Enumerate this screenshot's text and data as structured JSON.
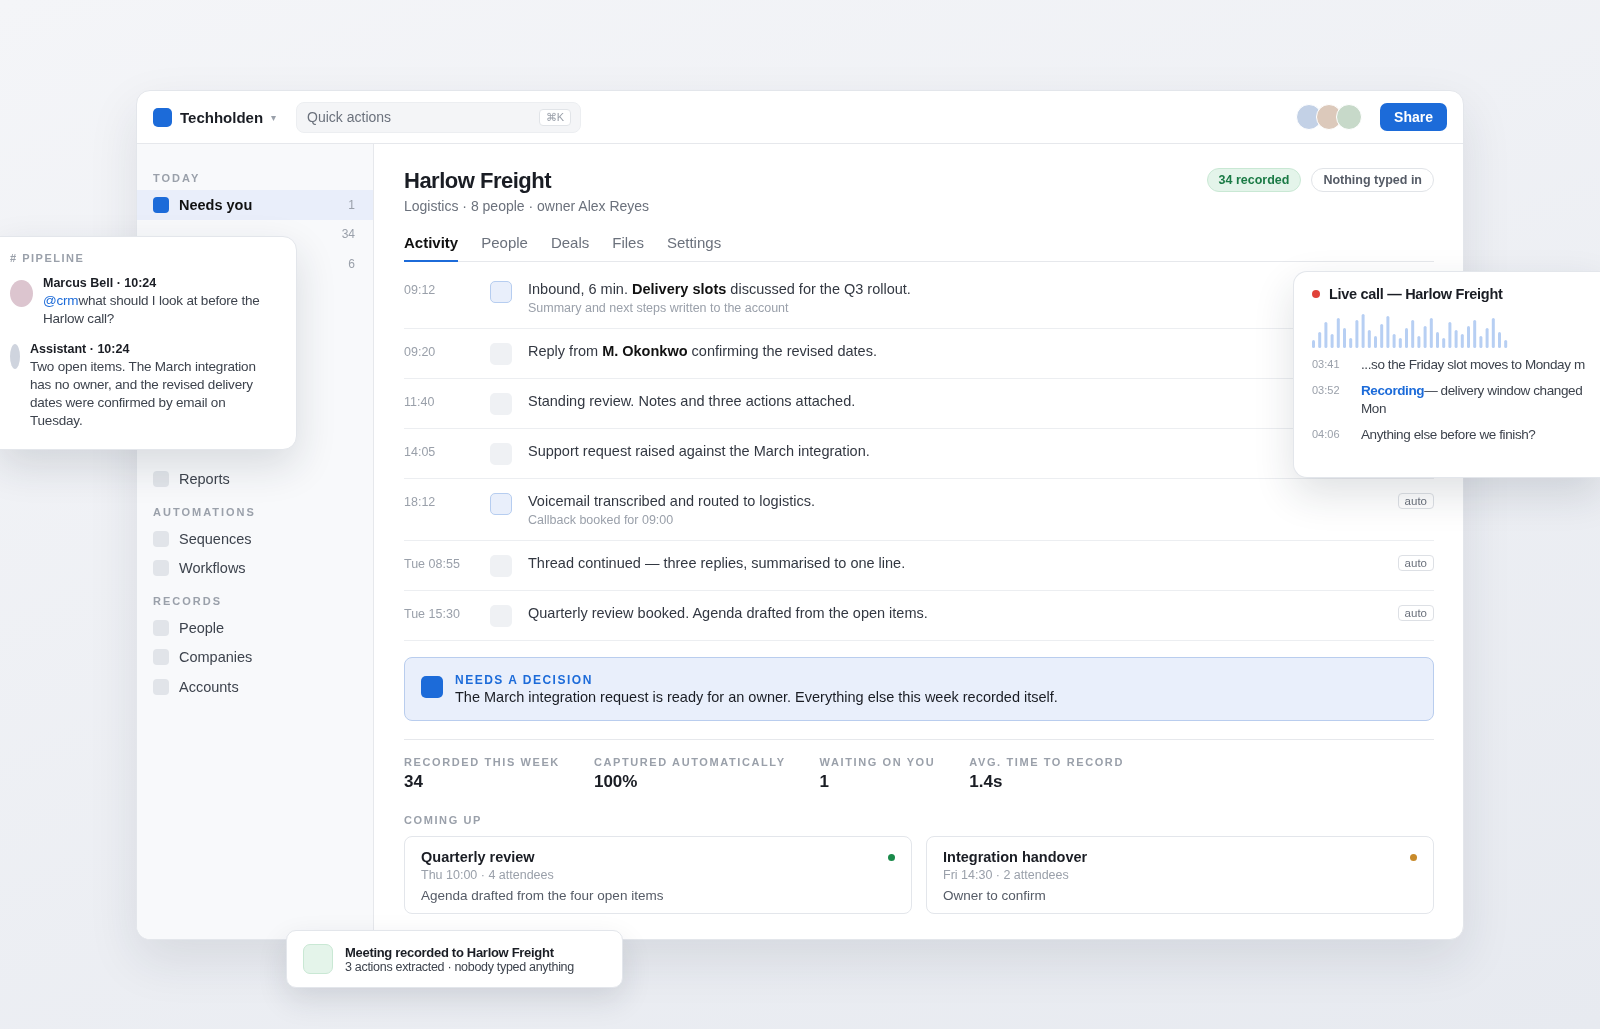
{
  "workspace": {
    "name": "Techholden",
    "caret": "▾"
  },
  "quick_actions": {
    "placeholder": "Quick actions",
    "shortcut": "⌘K"
  },
  "avatars": [
    {
      "color": "#c3d1e6"
    },
    {
      "color": "#dcc9bb"
    },
    {
      "color": "#c7d9c9"
    }
  ],
  "share_button": "Share",
  "sidebar": {
    "sections": [
      {
        "title": "TODAY",
        "items": [
          {
            "label": "Needs you",
            "count": "1",
            "selected": true
          },
          {
            "count": "34",
            "selected": false
          },
          {
            "count": "6",
            "selected": false
          }
        ]
      },
      {
        "items": [
          {
            "label": "Reports",
            "selected": false
          }
        ]
      },
      {
        "title": "AUTOMATIONS",
        "items": [
          {
            "label": "Sequences",
            "selected": false
          },
          {
            "label": "Workflows",
            "selected": false
          }
        ]
      },
      {
        "title": "RECORDS",
        "items": [
          {
            "label": "People",
            "selected": false
          },
          {
            "label": "Companies",
            "selected": false
          },
          {
            "label": "Accounts",
            "selected": false
          }
        ]
      }
    ]
  },
  "account": {
    "name": "Harlow Freight",
    "meta": "Logistics · 8 people · owner Alex Reyes",
    "badges": [
      {
        "text": "34 recorded",
        "kind": "success"
      },
      {
        "text": "Nothing typed in",
        "kind": "neutral"
      }
    ],
    "tabs": [
      {
        "label": "Activity",
        "selected": true
      },
      {
        "label": "People",
        "selected": false
      },
      {
        "label": "Deals",
        "selected": false
      },
      {
        "label": "Files",
        "selected": false
      },
      {
        "label": "Settings",
        "selected": false
      }
    ]
  },
  "activity": [
    {
      "time": "09:12",
      "highlighted": true,
      "text": "Inbound, 6 min. **Delivery slots** discussed for the Q3 rollout.",
      "note": "Summary and next steps written to the account"
    },
    {
      "time": "09:20",
      "highlighted": false,
      "text": "Reply from **M. Okonkwo** confirming the revised dates."
    },
    {
      "time": "11:40",
      "highlighted": false,
      "text": "Standing review. Notes and three actions attached."
    },
    {
      "time": "14:05",
      "highlighted": false,
      "text": "Support request raised against the March integration."
    },
    {
      "time": "18:12",
      "highlighted": true,
      "text": "Voicemail transcribed and routed to logistics.",
      "note": "Callback booked for 09:00",
      "tag": "auto"
    },
    {
      "time": "Tue 08:55",
      "highlighted": false,
      "text": "Thread continued — three replies, summarised to one line.",
      "tag": "auto"
    },
    {
      "time": "Tue 15:30",
      "highlighted": false,
      "text": "Quarterly review booked. Agenda drafted from the open items.",
      "tag": "auto"
    }
  ],
  "decision": {
    "title": "NEEDS A DECISION",
    "text": "The March integration request is ready for an owner. Everything else this week recorded itself."
  },
  "stats": [
    {
      "label": "RECORDED THIS WEEK",
      "value": "34"
    },
    {
      "label": "CAPTURED AUTOMATICALLY",
      "value": "100%"
    },
    {
      "label": "WAITING ON YOU",
      "value": "1"
    },
    {
      "label": "AVG. TIME TO RECORD",
      "value": "1.4s"
    }
  ],
  "coming_up": {
    "title": "COMING UP",
    "events": [
      {
        "title": "Quarterly review",
        "when": "Thu 10:00 · 4 attendees",
        "note": "Agenda drafted from the four open items",
        "color": "#1a8a4a"
      },
      {
        "title": "Integration handover",
        "when": "Fri 14:30 · 2 attendees",
        "note": "Owner to confirm",
        "color": "#c88a2a"
      }
    ]
  },
  "chat": {
    "channel": "# PIPELINE",
    "messages": [
      {
        "author": "Marcus Bell · 10:24",
        "mention": "@crm",
        "text": "what should I look at before the Harlow call?",
        "color": "#dcc5cf",
        "kind": "person"
      },
      {
        "author": "Assistant · 10:24",
        "text": "Two open items. The March integration has no owner, and the revised delivery dates were confirmed by email on Tuesday.",
        "color": "#cfd4de",
        "kind": "assistant"
      }
    ]
  },
  "live_call": {
    "title": "Live call — Harlow Freight",
    "live": true,
    "lines": [
      {
        "time": "03:41",
        "text": "...so the Friday slot moves to Monday m"
      },
      {
        "time": "03:52",
        "highlight": "Recording",
        "text": "— delivery window changed\nMon"
      },
      {
        "time": "04:06",
        "text": "Anything else before we finish?"
      }
    ]
  },
  "toast": {
    "title": "Meeting recorded to Harlow Freight",
    "text": "3 actions extracted · nobody typed anything"
  }
}
